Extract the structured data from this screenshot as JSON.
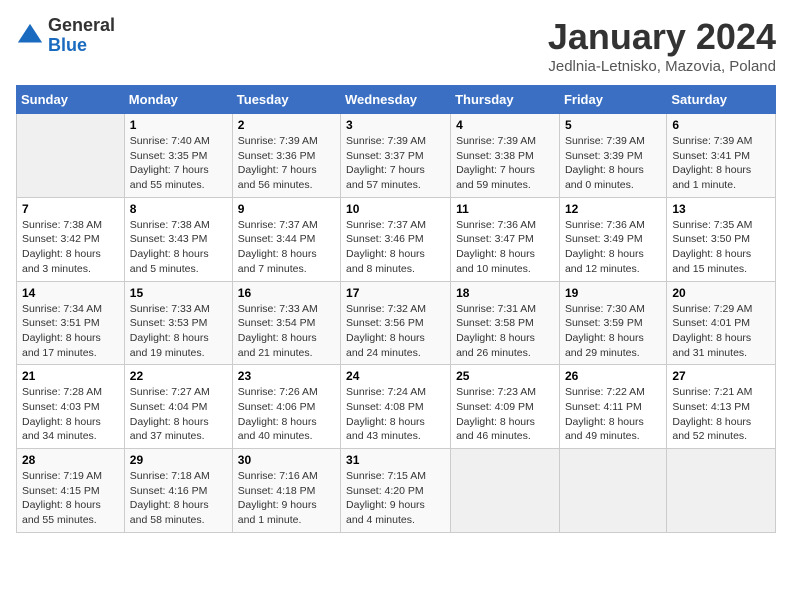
{
  "logo": {
    "general": "General",
    "blue": "Blue"
  },
  "title": "January 2024",
  "subtitle": "Jedlnia-Letnisko, Mazovia, Poland",
  "days_of_week": [
    "Sunday",
    "Monday",
    "Tuesday",
    "Wednesday",
    "Thursday",
    "Friday",
    "Saturday"
  ],
  "weeks": [
    [
      {
        "day": "",
        "content": ""
      },
      {
        "day": "1",
        "content": "Sunrise: 7:40 AM\nSunset: 3:35 PM\nDaylight: 7 hours\nand 55 minutes."
      },
      {
        "day": "2",
        "content": "Sunrise: 7:39 AM\nSunset: 3:36 PM\nDaylight: 7 hours\nand 56 minutes."
      },
      {
        "day": "3",
        "content": "Sunrise: 7:39 AM\nSunset: 3:37 PM\nDaylight: 7 hours\nand 57 minutes."
      },
      {
        "day": "4",
        "content": "Sunrise: 7:39 AM\nSunset: 3:38 PM\nDaylight: 7 hours\nand 59 minutes."
      },
      {
        "day": "5",
        "content": "Sunrise: 7:39 AM\nSunset: 3:39 PM\nDaylight: 8 hours\nand 0 minutes."
      },
      {
        "day": "6",
        "content": "Sunrise: 7:39 AM\nSunset: 3:41 PM\nDaylight: 8 hours\nand 1 minute."
      }
    ],
    [
      {
        "day": "7",
        "content": "Sunrise: 7:38 AM\nSunset: 3:42 PM\nDaylight: 8 hours\nand 3 minutes."
      },
      {
        "day": "8",
        "content": "Sunrise: 7:38 AM\nSunset: 3:43 PM\nDaylight: 8 hours\nand 5 minutes."
      },
      {
        "day": "9",
        "content": "Sunrise: 7:37 AM\nSunset: 3:44 PM\nDaylight: 8 hours\nand 7 minutes."
      },
      {
        "day": "10",
        "content": "Sunrise: 7:37 AM\nSunset: 3:46 PM\nDaylight: 8 hours\nand 8 minutes."
      },
      {
        "day": "11",
        "content": "Sunrise: 7:36 AM\nSunset: 3:47 PM\nDaylight: 8 hours\nand 10 minutes."
      },
      {
        "day": "12",
        "content": "Sunrise: 7:36 AM\nSunset: 3:49 PM\nDaylight: 8 hours\nand 12 minutes."
      },
      {
        "day": "13",
        "content": "Sunrise: 7:35 AM\nSunset: 3:50 PM\nDaylight: 8 hours\nand 15 minutes."
      }
    ],
    [
      {
        "day": "14",
        "content": "Sunrise: 7:34 AM\nSunset: 3:51 PM\nDaylight: 8 hours\nand 17 minutes."
      },
      {
        "day": "15",
        "content": "Sunrise: 7:33 AM\nSunset: 3:53 PM\nDaylight: 8 hours\nand 19 minutes."
      },
      {
        "day": "16",
        "content": "Sunrise: 7:33 AM\nSunset: 3:54 PM\nDaylight: 8 hours\nand 21 minutes."
      },
      {
        "day": "17",
        "content": "Sunrise: 7:32 AM\nSunset: 3:56 PM\nDaylight: 8 hours\nand 24 minutes."
      },
      {
        "day": "18",
        "content": "Sunrise: 7:31 AM\nSunset: 3:58 PM\nDaylight: 8 hours\nand 26 minutes."
      },
      {
        "day": "19",
        "content": "Sunrise: 7:30 AM\nSunset: 3:59 PM\nDaylight: 8 hours\nand 29 minutes."
      },
      {
        "day": "20",
        "content": "Sunrise: 7:29 AM\nSunset: 4:01 PM\nDaylight: 8 hours\nand 31 minutes."
      }
    ],
    [
      {
        "day": "21",
        "content": "Sunrise: 7:28 AM\nSunset: 4:03 PM\nDaylight: 8 hours\nand 34 minutes."
      },
      {
        "day": "22",
        "content": "Sunrise: 7:27 AM\nSunset: 4:04 PM\nDaylight: 8 hours\nand 37 minutes."
      },
      {
        "day": "23",
        "content": "Sunrise: 7:26 AM\nSunset: 4:06 PM\nDaylight: 8 hours\nand 40 minutes."
      },
      {
        "day": "24",
        "content": "Sunrise: 7:24 AM\nSunset: 4:08 PM\nDaylight: 8 hours\nand 43 minutes."
      },
      {
        "day": "25",
        "content": "Sunrise: 7:23 AM\nSunset: 4:09 PM\nDaylight: 8 hours\nand 46 minutes."
      },
      {
        "day": "26",
        "content": "Sunrise: 7:22 AM\nSunset: 4:11 PM\nDaylight: 8 hours\nand 49 minutes."
      },
      {
        "day": "27",
        "content": "Sunrise: 7:21 AM\nSunset: 4:13 PM\nDaylight: 8 hours\nand 52 minutes."
      }
    ],
    [
      {
        "day": "28",
        "content": "Sunrise: 7:19 AM\nSunset: 4:15 PM\nDaylight: 8 hours\nand 55 minutes."
      },
      {
        "day": "29",
        "content": "Sunrise: 7:18 AM\nSunset: 4:16 PM\nDaylight: 8 hours\nand 58 minutes."
      },
      {
        "day": "30",
        "content": "Sunrise: 7:16 AM\nSunset: 4:18 PM\nDaylight: 9 hours\nand 1 minute."
      },
      {
        "day": "31",
        "content": "Sunrise: 7:15 AM\nSunset: 4:20 PM\nDaylight: 9 hours\nand 4 minutes."
      },
      {
        "day": "",
        "content": ""
      },
      {
        "day": "",
        "content": ""
      },
      {
        "day": "",
        "content": ""
      }
    ]
  ]
}
